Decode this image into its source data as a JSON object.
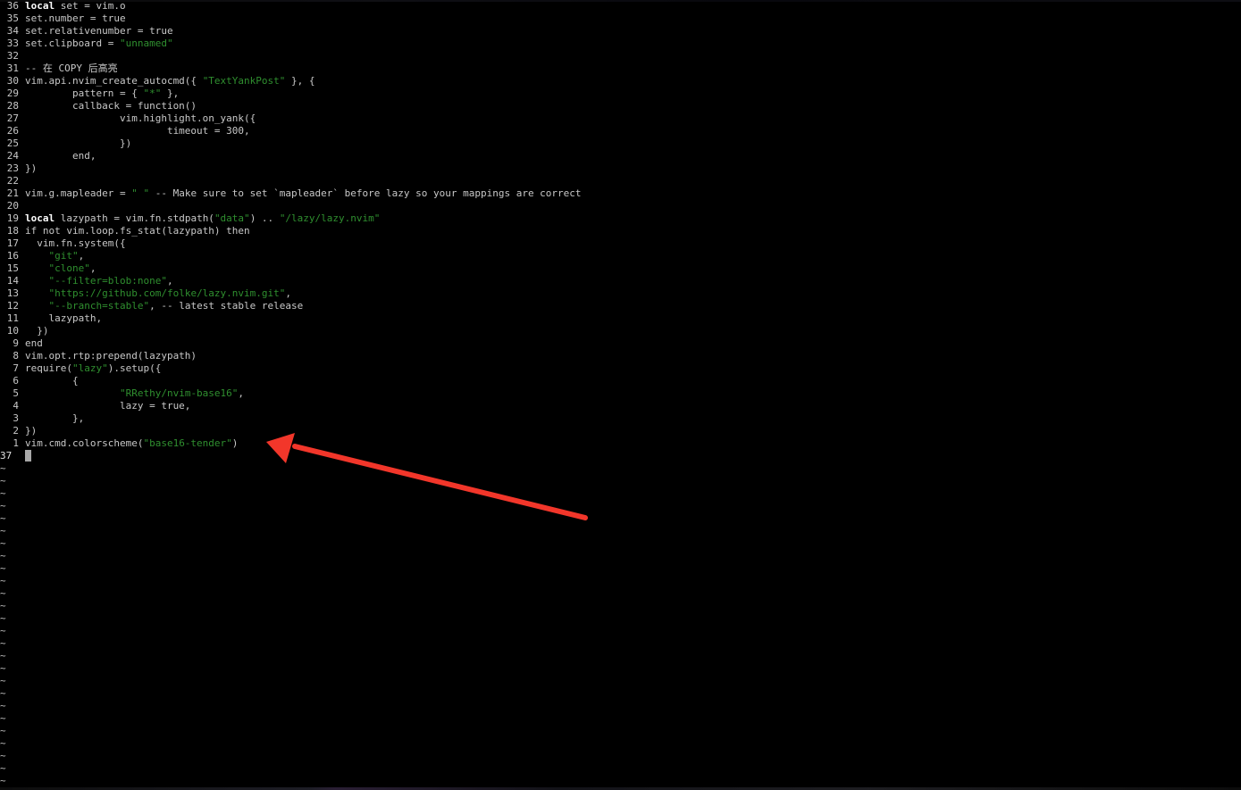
{
  "editor": {
    "lines": [
      {
        "num": "36",
        "segs": [
          {
            "t": "local",
            "c": "kw"
          },
          {
            "t": " set = vim.o"
          }
        ]
      },
      {
        "num": "35",
        "segs": [
          {
            "t": "set.number = true"
          }
        ]
      },
      {
        "num": "34",
        "segs": [
          {
            "t": "set.relativenumber = true"
          }
        ]
      },
      {
        "num": "33",
        "segs": [
          {
            "t": "set.clipboard = "
          },
          {
            "t": "\"unnamed\"",
            "c": "str"
          }
        ]
      },
      {
        "num": "32",
        "segs": []
      },
      {
        "num": "31",
        "segs": [
          {
            "t": "-- 在 COPY 后高亮"
          }
        ]
      },
      {
        "num": "30",
        "segs": [
          {
            "t": "vim.api.nvim_create_autocmd({ "
          },
          {
            "t": "\"TextYankPost\"",
            "c": "str"
          },
          {
            "t": " }, {"
          }
        ]
      },
      {
        "num": "29",
        "segs": [
          {
            "t": "        pattern = { "
          },
          {
            "t": "\"*\"",
            "c": "str"
          },
          {
            "t": " },"
          }
        ]
      },
      {
        "num": "28",
        "segs": [
          {
            "t": "        callback = function()"
          }
        ]
      },
      {
        "num": "27",
        "segs": [
          {
            "t": "                vim.highlight.on_yank({"
          }
        ]
      },
      {
        "num": "26",
        "segs": [
          {
            "t": "                        timeout = 300,"
          }
        ]
      },
      {
        "num": "25",
        "segs": [
          {
            "t": "                })"
          }
        ]
      },
      {
        "num": "24",
        "segs": [
          {
            "t": "        end,"
          }
        ]
      },
      {
        "num": "23",
        "segs": [
          {
            "t": "})"
          }
        ]
      },
      {
        "num": "22",
        "segs": []
      },
      {
        "num": "21",
        "segs": [
          {
            "t": "vim.g.mapleader = "
          },
          {
            "t": "\" \"",
            "c": "str"
          },
          {
            "t": " -- Make sure to set `mapleader` before lazy so your mappings are correct"
          }
        ]
      },
      {
        "num": "20",
        "segs": []
      },
      {
        "num": "19",
        "segs": [
          {
            "t": "local",
            "c": "kw"
          },
          {
            "t": " lazypath = vim.fn.stdpath("
          },
          {
            "t": "\"data\"",
            "c": "str"
          },
          {
            "t": ") .. "
          },
          {
            "t": "\"/lazy/lazy.nvim\"",
            "c": "str"
          }
        ]
      },
      {
        "num": "18",
        "segs": [
          {
            "t": "if not vim.loop.fs_stat(lazypath) then"
          }
        ]
      },
      {
        "num": "17",
        "segs": [
          {
            "t": "  vim.fn.system({"
          }
        ]
      },
      {
        "num": "16",
        "segs": [
          {
            "t": "    "
          },
          {
            "t": "\"git\"",
            "c": "str"
          },
          {
            "t": ","
          }
        ]
      },
      {
        "num": "15",
        "segs": [
          {
            "t": "    "
          },
          {
            "t": "\"clone\"",
            "c": "str"
          },
          {
            "t": ","
          }
        ]
      },
      {
        "num": "14",
        "segs": [
          {
            "t": "    "
          },
          {
            "t": "\"--filter=blob:none\"",
            "c": "str"
          },
          {
            "t": ","
          }
        ]
      },
      {
        "num": "13",
        "segs": [
          {
            "t": "    "
          },
          {
            "t": "\"https://github.com/folke/lazy.nvim.git\"",
            "c": "str"
          },
          {
            "t": ","
          }
        ]
      },
      {
        "num": "12",
        "segs": [
          {
            "t": "    "
          },
          {
            "t": "\"--branch=stable\"",
            "c": "str"
          },
          {
            "t": ", -- latest stable release"
          }
        ]
      },
      {
        "num": "11",
        "segs": [
          {
            "t": "    lazypath,"
          }
        ]
      },
      {
        "num": "10",
        "segs": [
          {
            "t": "  })"
          }
        ]
      },
      {
        "num": "9",
        "segs": [
          {
            "t": "end"
          }
        ]
      },
      {
        "num": "8",
        "segs": [
          {
            "t": "vim.opt.rtp:prepend(lazypath)"
          }
        ]
      },
      {
        "num": "7",
        "segs": [
          {
            "t": "require("
          },
          {
            "t": "\"lazy\"",
            "c": "str"
          },
          {
            "t": ").setup({"
          }
        ]
      },
      {
        "num": "6",
        "segs": [
          {
            "t": "        {"
          }
        ]
      },
      {
        "num": "5",
        "segs": [
          {
            "t": "                "
          },
          {
            "t": "\"RRethy/nvim-base16\"",
            "c": "str"
          },
          {
            "t": ","
          }
        ]
      },
      {
        "num": "4",
        "segs": [
          {
            "t": "                lazy = true,"
          }
        ]
      },
      {
        "num": "3",
        "segs": [
          {
            "t": "        },"
          }
        ]
      },
      {
        "num": "2",
        "segs": [
          {
            "t": "})"
          }
        ]
      },
      {
        "num": "1",
        "segs": [
          {
            "t": "vim.cmd.colorscheme("
          },
          {
            "t": "\"base16-tender\"",
            "c": "str"
          },
          {
            "t": ")"
          }
        ]
      }
    ],
    "cursor_line_num": "37",
    "tilde": "~",
    "tilde_count": 26
  },
  "colors": {
    "background": "#000000",
    "text": "#c8c8c8",
    "string": "#2f8f2f",
    "keyword": "#ffffff",
    "annotation_arrow": "#f2362a"
  }
}
